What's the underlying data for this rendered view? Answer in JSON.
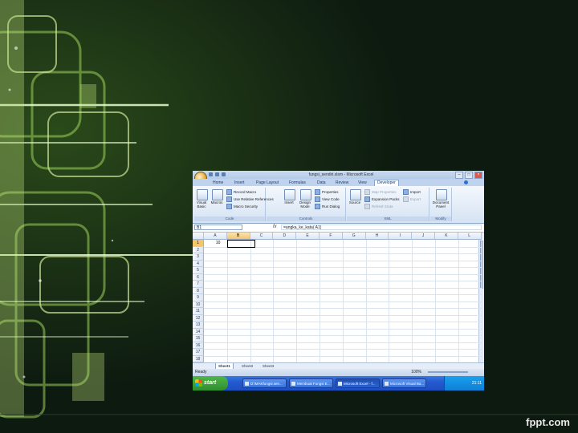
{
  "footer": {
    "brand": "fppt.com"
  },
  "excel": {
    "title": "fungsi_sendiri.xlsm - Microsoft Excel",
    "tabs": [
      "Home",
      "Insert",
      "Page Layout",
      "Formulas",
      "Data",
      "Review",
      "View",
      "Developer"
    ],
    "active_tab": "Developer",
    "ribbon": {
      "code": {
        "label": "Code",
        "visual_basic": "Visual Basic",
        "macros": "Macros",
        "record_macro": "Record Macro",
        "relative_refs": "Use Relative References",
        "macro_security": "Macro Security"
      },
      "controls": {
        "label": "Controls",
        "insert": "Insert",
        "design_mode": "Design Mode",
        "properties": "Properties",
        "view_code": "View Code",
        "run_dialog": "Run Dialog"
      },
      "xml": {
        "label": "XML",
        "source": "Source",
        "map_properties": "Map Properties",
        "expansion_packs": "Expansion Packs",
        "refresh_data": "Refresh Data",
        "import": "Import",
        "export": "Export"
      },
      "modify": {
        "label": "Modify",
        "document_panel": "Document Panel"
      }
    },
    "name_box": "B1",
    "fx_symbol": "fx",
    "formula": "=angka_ke_kata( A1)",
    "columns": [
      "A",
      "B",
      "C",
      "D",
      "E",
      "F",
      "G",
      "H",
      "I",
      "J",
      "K",
      "L"
    ],
    "selected_column": "B",
    "rows": [
      "1",
      "2",
      "3",
      "4",
      "5",
      "6",
      "7",
      "8",
      "9",
      "10",
      "11",
      "12",
      "13",
      "14",
      "15",
      "16",
      "17",
      "18"
    ],
    "selected_row": "1",
    "cell_a1": "10",
    "sheets": [
      "Sheet1",
      "Sheet2",
      "Sheet3"
    ],
    "active_sheet": "Sheet1",
    "status": "Ready",
    "zoom": "100%"
  },
  "taskbar": {
    "start": "start",
    "buttons": [
      "D:\\MAKfungsi.sen...",
      "Membuat Fungsi E...",
      "Microsoft Excel - f...",
      "Microsoft Visual Ba..."
    ],
    "active_index": 2,
    "time": "21:11"
  }
}
